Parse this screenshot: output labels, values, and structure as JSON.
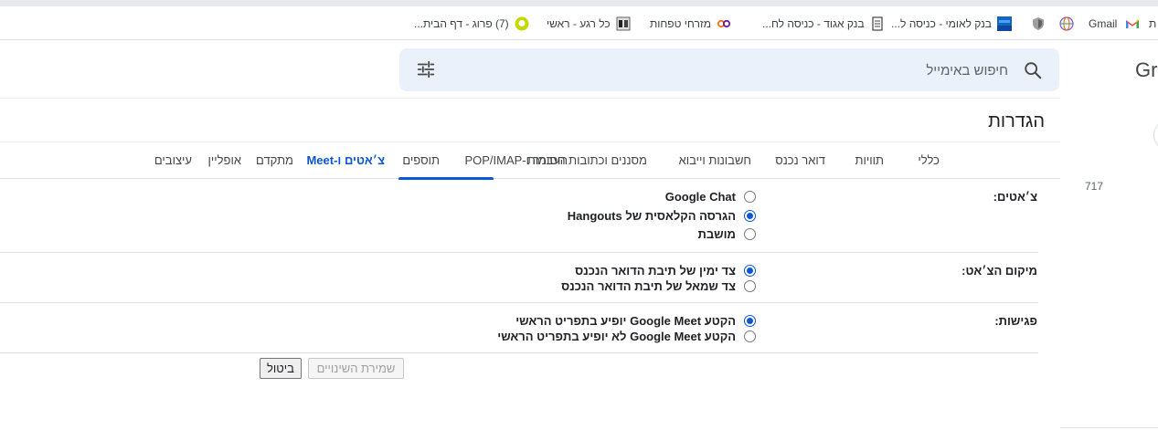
{
  "bookmarks": [
    {
      "label": "ת",
      "icon": "partial-bookmark"
    },
    {
      "label": "",
      "icon": "gmail-icon"
    },
    {
      "label": "Gmail",
      "icon": "none"
    },
    {
      "label": "",
      "icon": "globe-icon"
    },
    {
      "label": "",
      "icon": "shield-icon"
    },
    {
      "label": "בנק לאומי - כניסה ל...",
      "icon": "bank-leumi-icon"
    },
    {
      "label": "בנק אגוד - כניסה לח...",
      "icon": "document-icon"
    },
    {
      "label": "מזרחי טפחות",
      "icon": "mizrahi-icon"
    },
    {
      "label": "כל רגע - ראשי",
      "icon": "news-icon"
    },
    {
      "label": "(7) פרוג - דף הבית...",
      "icon": "chat-bubble-icon"
    }
  ],
  "search": {
    "placeholder": "חיפוש באימייל"
  },
  "logo_partial": "Gr",
  "side_count": "717",
  "page_title": "הגדרות",
  "tabs": [
    {
      "label": "כללי"
    },
    {
      "label": "תוויות"
    },
    {
      "label": "דואר נכנס"
    },
    {
      "label": "חשבונות וייבוא"
    },
    {
      "label": "מסננים וכתובות חסומות"
    },
    {
      "label": "העברה ו-POP/IMAP"
    },
    {
      "label": "תוספים"
    },
    {
      "label": "צ׳אטים ו-Meet"
    },
    {
      "label": "מתקדם"
    },
    {
      "label": "אופליין"
    },
    {
      "label": "עיצובים"
    }
  ],
  "active_tab": "צ׳אטים ו-Meet",
  "settings": {
    "chat": {
      "label": "צ׳אטים:",
      "options": [
        "Google Chat",
        "הגרסה הקלאסית של Hangouts",
        "מושבת"
      ],
      "selected_index": 1
    },
    "chat_position": {
      "label": "מיקום הצ׳אט:",
      "options": [
        "צד ימין של תיבת הדואר הנכנס",
        "צד שמאל של תיבת הדואר הנכנס"
      ],
      "selected_index": 0
    },
    "meet": {
      "label": "פגישות:",
      "options": [
        "הקטע Google Meet יופיע בתפריט הראשי",
        "הקטע Google Meet לא יופיע בתפריט הראשי"
      ],
      "selected_index": 0
    }
  },
  "buttons": {
    "save": "שמירת השינויים",
    "cancel": "ביטול"
  },
  "colors": {
    "accent": "#0b57d0",
    "search_bg": "#eaf1fb"
  }
}
